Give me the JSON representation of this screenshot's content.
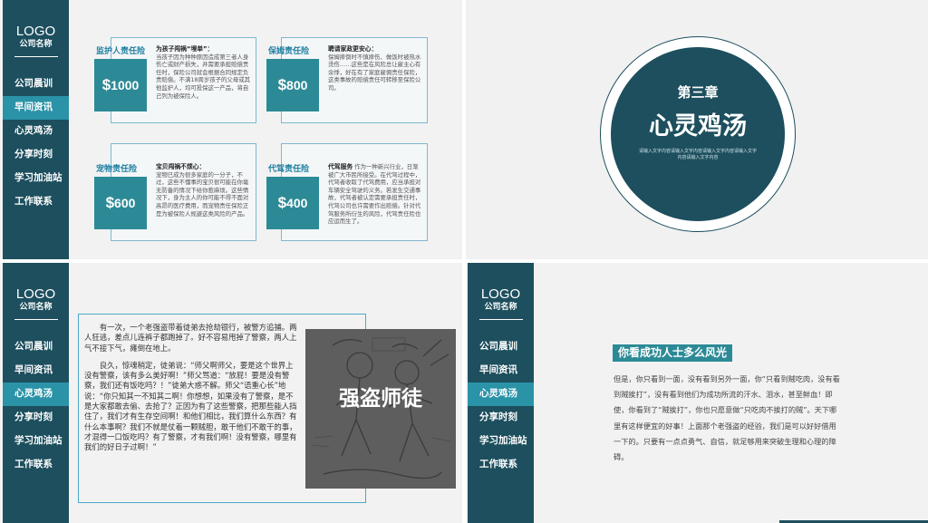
{
  "sidebar": {
    "logo": "LOGO",
    "company": "公司名称",
    "items": [
      "公司晨训",
      "早间资讯",
      "心灵鸡汤",
      "分享时刻",
      "学习加油站",
      "工作联系"
    ]
  },
  "slide1": {
    "cards": [
      {
        "title": "监护人责任险",
        "currency": "$",
        "amount": "1000",
        "heading": "为孩子闯祸“埋单”：",
        "body": "当孩子因为种种原因造成第三者人身伤亡或财产损失，并需要承担赔偿责任时，保险公司就会根据合同规定负责赔偿。不满18周岁孩子的父母或其他监护人，均可投保这一产品，将自己列为被保险人。"
      },
      {
        "title": "保姆责任险",
        "currency": "$",
        "amount": "800",
        "heading": "聘请家政更安心：",
        "body": "保姆摔倒时不慎摔伤、做饭时被热水烫伤……这些是在风险总让雇主心有余悸，好在有了家庭雇佣责任保险，这类事故的赔偿责任可转移至保险公司。"
      },
      {
        "title": "宠物责任险",
        "currency": "$",
        "amount": "600",
        "heading": "宝贝闯祸不烦心：",
        "body": "宠物已成为很多家庭的一分子，不过，这些不懂事的宝贝很可能在你毫无防备的情况下给你惹麻烦。这些情况下，身为主人的你可能不得不面对高昂的医疗费用，而宠物责任保险正是为被保险人规避这类风险的产品。"
      },
      {
        "title": "代驾责任险",
        "currency": "$",
        "amount": "400",
        "heading": "代驾服务",
        "body": "作为一种新兴行业，日渐被广大市民所接受。在代驾过程中，代驾者收取了代驾费用，应当承担对车辆安全驾驶的义务。若发生交通事故，代驾者被认定需要承担责任时，代驾公司也许需要作出赔偿。针对代驾服务所衍生的风险，代驾责任险也应运而生了。"
      }
    ]
  },
  "slide2": {
    "chapter": "第三章",
    "title": "心灵鸡汤",
    "desc": "请输入文字内容请输入文字内容请输入文字内容请输入文字内容请输入文字内容"
  },
  "slide3": {
    "caption": "强盗师徒",
    "paragraphs": [
      "有一次，一个老强盗带着徒弟去抢劫银行，被警方追捕。两人狂逃，差点儿连裤子都跑掉了。好不容易甩掉了警察，两人上气不接下气，瘫倒在地上。",
      "良久，惊魂稍定，徒弟说：“师父啊师父，要是这个世界上没有警察，该有多么美好啊！”师父骂道：“放屁！要是没有警察，我们还有饭吃吗？！”徒弟大惑不解。师父“语重心长”地说：“你只知其一不知其二啊！你想想，如果没有了警察，是不是大家都敢去偷、去抢了？正因为有了这些警察，把那些能人挡住了，我们才有生存空间啊！和他们相比，我们算什么东西？有什么本事啊？我们不就是仗着一颗贼胆，敢干他们不敢干的事，才混得一口饭吃吗？有了警察，才有我们啊！没有警察，哪里有我们的好日子过啊！”"
    ]
  },
  "slide4": {
    "title": "你看成功人士多么风光",
    "text": "但是，你只看到一面，没有看到另外一面，你“只看到贼吃肉，没有看到贼挨打”，没有看到他们为成功所流的汗水、泪水，甚至鲜血！即使，你看到了“贼挨打”，你也只愿意做“只吃肉不挨打的贼”。天下哪里有这样便宜的好事！上面那个老强盗的经验，我们是可以好好借用一下的。只要有一点点勇气、自信，就足够用来突破生理和心理的障碍。"
  },
  "colors": {
    "dark_teal": "#1d4f5e",
    "accent_teal": "#2c8a96",
    "active_nav": "#2a93a8",
    "frame_blue": "#4aa9c9"
  }
}
